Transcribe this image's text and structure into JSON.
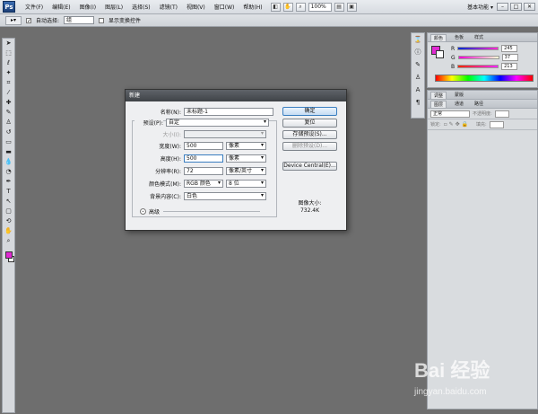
{
  "app": {
    "logo": "Ps",
    "workspace": "基本功能 ▾"
  },
  "menu": [
    "文件(F)",
    "编辑(E)",
    "图像(I)",
    "图层(L)",
    "选择(S)",
    "滤镜(T)",
    "视图(V)",
    "窗口(W)",
    "帮助(H)"
  ],
  "menubar_tools": {
    "zoom": "100%"
  },
  "window_buttons": {
    "minimize": "–",
    "restore": "□",
    "close": "✕"
  },
  "options": {
    "auto_select_label": "自动选择:",
    "auto_select_value": "组",
    "show_transform_label": "显示变换控件"
  },
  "panels": {
    "color_tabs": [
      "颜色",
      "色板",
      "样式"
    ],
    "sliders": [
      {
        "label": "R",
        "value": "245",
        "gradient": "#e02ad2"
      },
      {
        "label": "G",
        "value": "37",
        "gradient": "#2ad2e0"
      },
      {
        "label": "B",
        "value": "213",
        "gradient": "#d2e02a"
      }
    ],
    "adjust_tabs": [
      "调整",
      "蒙版"
    ],
    "layers_tabs": [
      "图层",
      "通道",
      "路径"
    ],
    "blend_mode": "正常",
    "opacity_label": "不透明度:",
    "lock_label": "锁定:",
    "fill_label": "填充:"
  },
  "dialog": {
    "title": "新建",
    "name_label": "名称(N):",
    "name_value": "未标题-1",
    "preset_label": "预设(P):",
    "preset_value": "自定",
    "size_label": "大小(I):",
    "width_label": "宽度(W):",
    "width_value": "500",
    "width_unit": "像素",
    "height_label": "高度(H):",
    "height_value": "500",
    "height_unit": "像素",
    "resolution_label": "分辨率(R):",
    "resolution_value": "72",
    "resolution_unit": "像素/英寸",
    "color_mode_label": "颜色模式(M):",
    "color_mode_value": "RGB 颜色",
    "bit_depth_value": "8 位",
    "background_label": "背景内容(C):",
    "background_value": "白色",
    "advanced_label": "高级",
    "buttons": {
      "ok": "确定",
      "reset": "复位",
      "save_preset": "存储预设(S)...",
      "delete_preset": "删除预设(D)...",
      "device_central": "Device Central(E)..."
    },
    "image_size_label": "图像大小:",
    "image_size_value": "732.4K"
  },
  "watermark": {
    "brand": "Bai 经验",
    "url": "jingyan.baidu.com"
  },
  "colors": {
    "foreground": "#e02ad2",
    "background": "#ffffff",
    "canvas": "#6e6e6e"
  }
}
